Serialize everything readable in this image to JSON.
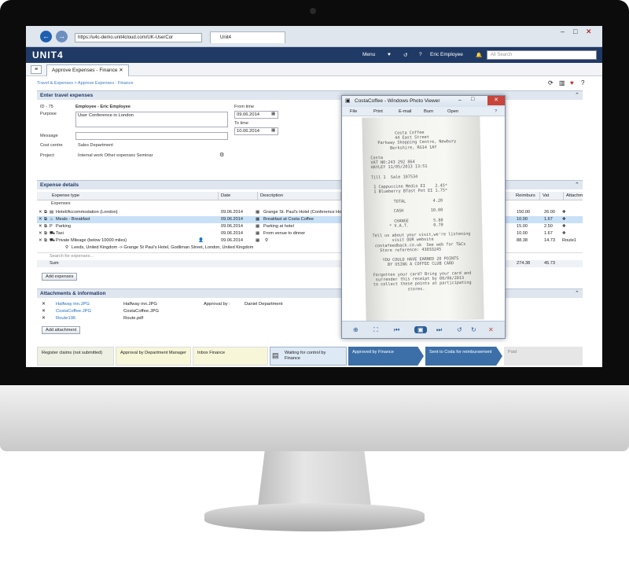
{
  "browser": {
    "url": "https://u4c-demo.unit4cloud.com/UK-UserCor",
    "tab_title": "Unit4"
  },
  "app": {
    "logo": "UNIT4",
    "menu": "Menu",
    "user": "Eric Employee",
    "search_scope": "All",
    "search_placeholder": "Search"
  },
  "page_tab": "Approve Expenses - Finance",
  "breadcrumb": "Travel & Expenses > Approve Expenses - Finance",
  "enter": {
    "title": "Enter travel expenses",
    "id_label": "ID - 75",
    "employee": "Employee - Eric Employee",
    "purpose_label": "Purpose",
    "purpose": "User Conference in London",
    "message_label": "Message",
    "cost_centre_label": "Cost centre",
    "cost_centre": "Sales Department",
    "project_label": "Project:",
    "project": "Internal work Other expenses Seminar",
    "from_label": "From time",
    "from": "09.06.2014",
    "to_label": "To time",
    "to": "10.06.2014"
  },
  "expense": {
    "title": "Expense details",
    "headers": [
      "Expense type",
      "Date",
      "Description",
      "Reimburs",
      "Vat",
      "Attachment"
    ],
    "group": "Expenses",
    "rows": [
      {
        "type": "Hotel/Accommodation (London)",
        "date": "09.06.2014",
        "desc": "Grange St. Paul's Hotel (Conference Hotel)",
        "reimb": "150.00",
        "vat": "26.00",
        "att": ""
      },
      {
        "type": "Meals - Breakfast",
        "date": "09.06.2014",
        "desc": "Breakfast at Costa Coffee",
        "reimb": "10.00",
        "vat": "1.67",
        "att": ""
      },
      {
        "type": "Parking",
        "date": "09.06.2014",
        "desc": "Parking at hotel",
        "reimb": "15.00",
        "vat": "2.50",
        "att": ""
      },
      {
        "type": "Taxi",
        "date": "09.06.2014",
        "desc": "From venue to dinner",
        "reimb": "10.00",
        "vat": "1.67",
        "att": ""
      },
      {
        "type": "Private Mileage (below 10000 miles)",
        "date": "09.06.2014",
        "desc": "",
        "reimb": "88.38",
        "vat": "14.73",
        "att": "Route1"
      }
    ],
    "route": "Leeds, United Kingdom -> Grange St Paul's Hotel, Godliman Street, London, United Kingdom",
    "search_placeholder": "Search for expenses...",
    "sum_label": "Sum",
    "sum_reimb": "274.38",
    "sum_vat": "45.73",
    "add": "Add expenses"
  },
  "attach": {
    "title": "Attachments & information",
    "files": [
      {
        "link": "Halfway inn.JPG",
        "name": "Halfway inn.JPG"
      },
      {
        "link": "CostaCoffee.JPG",
        "name": "CostaCoffee.JPG"
      },
      {
        "link": "Route196",
        "name": "Route.pdf"
      }
    ],
    "approval_label": "Approval by :",
    "approval": "Daniel Department",
    "add": "Add attachment"
  },
  "workflow": [
    "Register claims (not submitted)",
    "Approval by Department Manager",
    "Inbox Finance",
    "Waiting for control by Finance",
    "Approved by Finance",
    "Sent to Coda for reimbursement",
    "Paid"
  ],
  "viewer": {
    "title": "CostaCoffee - Windows Photo Viewer",
    "menu": [
      "File",
      "Print",
      "E-mail",
      "Burn",
      "Open"
    ],
    "receipt": "          Costa Coffee\n          44 East Street\n   Parkway Shopping Centre, Newbury\n        Berkshire, RG14 1AY\n\nCosta\nVAT NO:243 292 864\nHAYLEY 11/05/2013 13:51\n\nTill 1  Sale 107534\n\n 1 Cappuccino Medio EI    2.45*\n 1 Blueberry Bfast Pot EI 1.75*\n\n         TOTAL           4.20\n\n         CASH           10.00\n\n         CHANGE          5.80\n       * V.A.T.          0.70\n\nTell us about your visit,we're listening\n        visit OUR website\n costafeedback.co.uk  See web for T&Cs\n   Store reference: 43033245\n\n    YOU COULD HAVE EARNED 20 POINTS\n      BY USING A COFFEE CLUB CARD\n\nForgotten your card? Bring your card and\n surrender this receipt by 08/06/2013\nto collect these points at participating\n              stores."
  },
  "colors": {
    "appbar": "#203a66",
    "accent": "#3c6fa8",
    "selected": "#c9e1f7"
  }
}
